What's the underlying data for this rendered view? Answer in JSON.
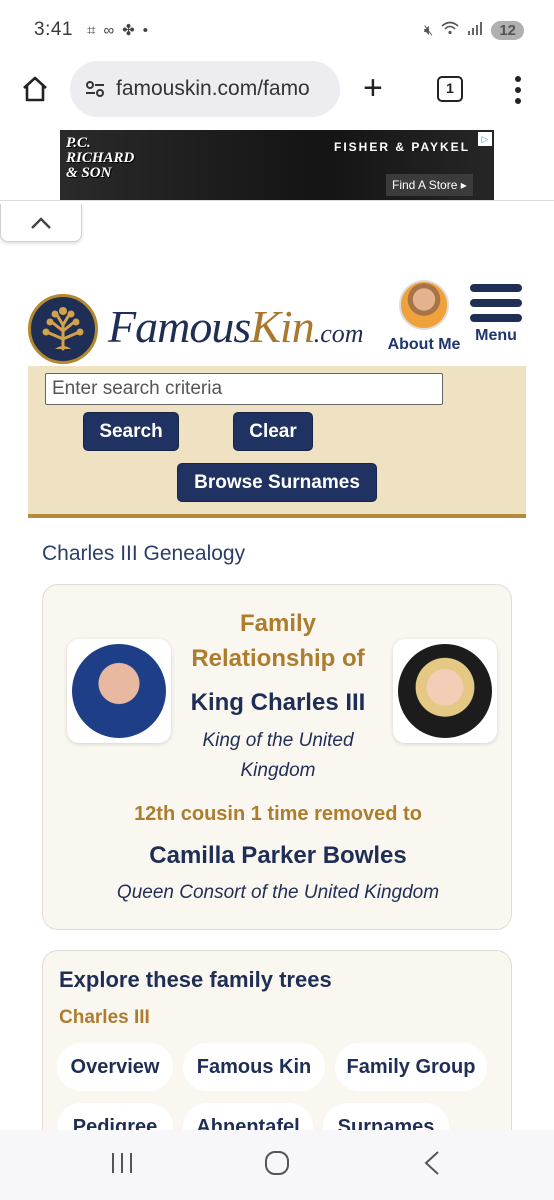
{
  "status": {
    "time": "3:41",
    "icons": [
      "screenshot-icon",
      "voicemail-icon",
      "pinwheel-icon",
      "dot"
    ],
    "battery": "12"
  },
  "browser": {
    "url": "famouskin.com/famo",
    "tab_count": "1"
  },
  "ad": {
    "logo_line1": "P.C.",
    "logo_line2": "RICHARD",
    "logo_line3": "& SON",
    "brand": "FISHER & PAYKEL",
    "cta": "Find A Store ▸"
  },
  "header": {
    "logo_part1": "Famous",
    "logo_part2": "Kin",
    "logo_part3": ".com",
    "about_label": "About Me",
    "menu_label": "Menu"
  },
  "search": {
    "placeholder": "Enter search criteria",
    "search_button": "Search",
    "clear_button": "Clear",
    "browse_button": "Browse Surnames"
  },
  "page": {
    "title": "Charles III Genealogy"
  },
  "relationship": {
    "heading_line1": "Family",
    "heading_line2": "Relationship of",
    "person1_name": "King Charles III",
    "person1_title_line1": "King of the United",
    "person1_title_line2": "Kingdom",
    "relation": "12th cousin 1 time removed to",
    "person2_name": "Camilla Parker Bowles",
    "person2_title": "Queen Consort of the United Kingdom"
  },
  "explore": {
    "title": "Explore these family trees",
    "subtitle": "Charles III",
    "pills": [
      "Overview",
      "Famous Kin",
      "Family Group",
      "Pedigree",
      "Ahnentafel",
      "Surnames"
    ]
  },
  "colors": {
    "navy": "#1f2e55",
    "gold": "#ad7d2e",
    "panel": "#efe2c3"
  }
}
